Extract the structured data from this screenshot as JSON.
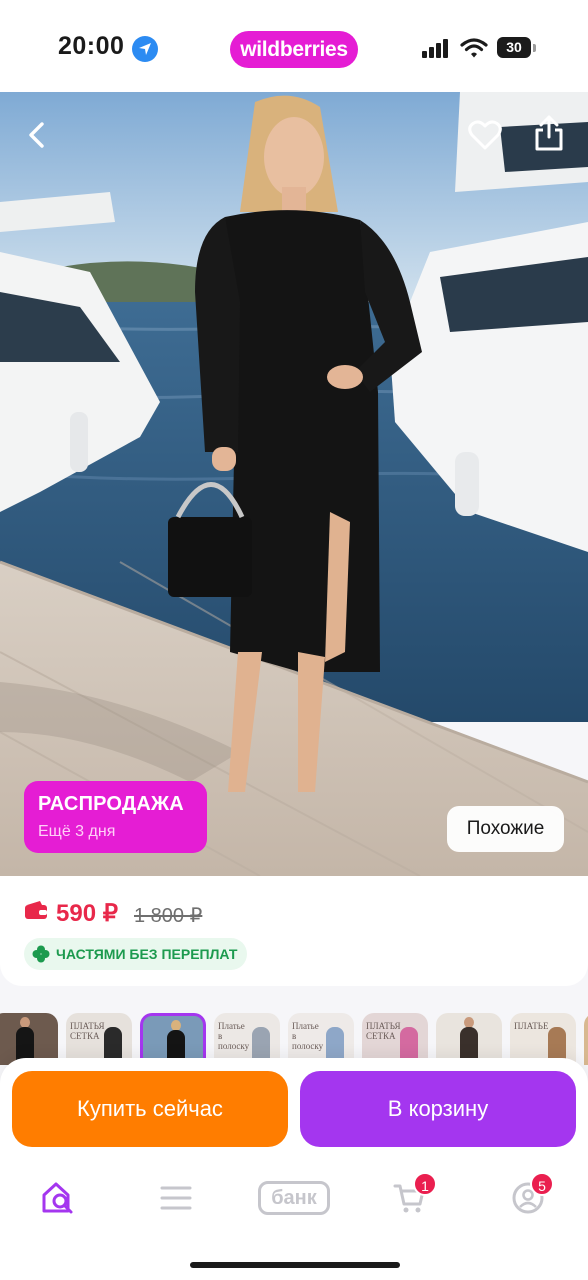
{
  "status_bar": {
    "time": "20:00",
    "brand": "wildberries",
    "battery": "30",
    "icons": [
      "location-arrow-icon",
      "cellular-signal-icon",
      "wifi-icon",
      "battery-icon"
    ]
  },
  "hero": {
    "image": "product-photo-black-midi-dress-on-pier",
    "icons": [
      "back-chevron-icon",
      "heart-icon",
      "share-icon"
    ],
    "sale_badge": {
      "title": "РАСПРОДАЖА",
      "subtitle": "Ещё 3 дня"
    },
    "similar_label": "Похожие"
  },
  "product": {
    "price": "590 ₽",
    "old_price": "1 800 ₽",
    "installment_label": "ЧАСТЯМИ БЕЗ ПЕРЕПЛАТ",
    "icons": [
      "wallet-icon",
      "clover-icon"
    ]
  },
  "thumbnails": [
    {
      "kind": "photo",
      "text": ""
    },
    {
      "kind": "text",
      "text": "ПЛАТЬЯ СЕТКА"
    },
    {
      "kind": "photo",
      "text": "",
      "active": true
    },
    {
      "kind": "text",
      "text": "Платье в полоску"
    },
    {
      "kind": "text",
      "text": "Платье в полоску"
    },
    {
      "kind": "text",
      "text": "ПЛАТЬЯ СЕТКА"
    },
    {
      "kind": "photo",
      "text": ""
    },
    {
      "kind": "text",
      "text": "ПЛАТЬЕ"
    },
    {
      "kind": "photo",
      "text": ""
    }
  ],
  "actions": {
    "buy_now": "Купить сейчас",
    "add_to_cart": "В корзину"
  },
  "tabbar": {
    "bank_label": "банк",
    "cart_badge": "1",
    "profile_badge": "5",
    "icons": [
      "home-search-icon",
      "menu-icon",
      "bank-icon",
      "cart-icon",
      "profile-icon"
    ]
  },
  "colors": {
    "brand": "#e51dd4",
    "price": "#e8284a",
    "buy_now": "#ff7d00",
    "cart": "#a436ef",
    "installment": "#1c9a4e"
  }
}
